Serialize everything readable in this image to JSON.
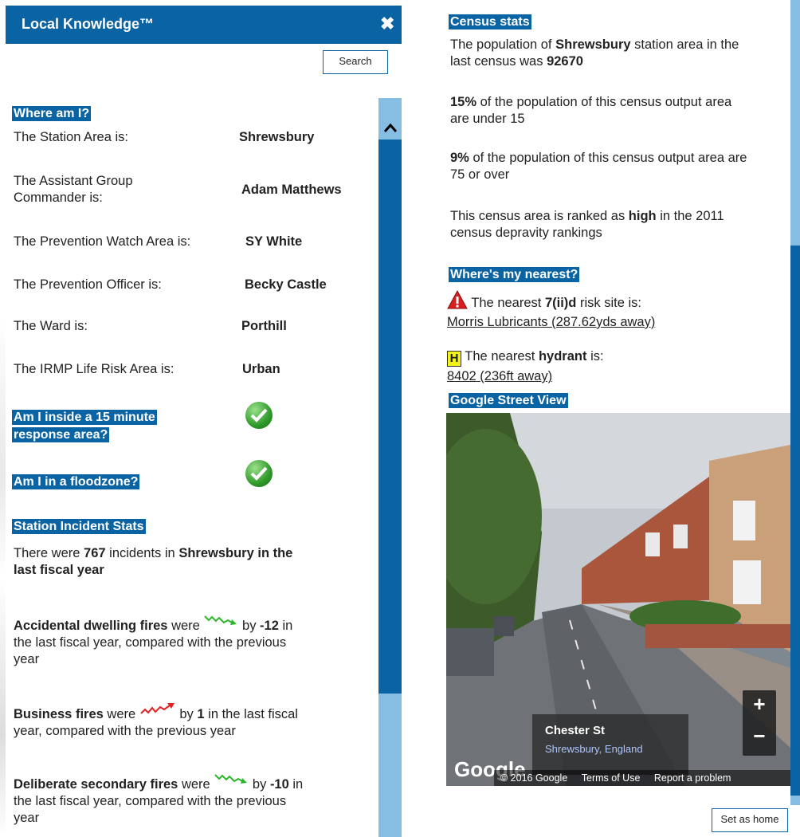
{
  "header": {
    "title": "Local Knowledge™",
    "close": "✖",
    "search_label": "Search"
  },
  "where": {
    "heading": "Where am I?",
    "rows": [
      {
        "label": "The Station Area is:",
        "value": "Shrewsbury"
      },
      {
        "label": "The Assistant Group",
        "label2": "Commander is:",
        "value": "Adam Matthews"
      },
      {
        "label": "The Prevention Watch Area is:",
        "value": "SY White"
      },
      {
        "label": "The Prevention Officer is:",
        "value": "Becky Castle"
      },
      {
        "label": "The Ward is:",
        "value": "Porthill"
      },
      {
        "label": "The IRMP Life Risk Area is:",
        "value": "Urban"
      }
    ],
    "response_q1": "Am I inside a 15 minute",
    "response_q2": "response area?",
    "flood_q": "Am I in a floodzone?"
  },
  "incidents": {
    "heading": "Station Incident Stats",
    "intro_pre": "There were",
    "count": "767",
    "intro_mid": "incidents in",
    "station": "Shrewsbury in the",
    "intro_end": "last fiscal year",
    "stats": [
      {
        "name": "Accidental dwelling fires",
        "verb": "were",
        "by": "by",
        "change": "-12",
        "line1_tail": "in",
        "line2": "the last fiscal year, compared with the previous",
        "line3": "year",
        "trend": "down"
      },
      {
        "name": "Business fires",
        "verb": "were",
        "by": "by",
        "change": "1",
        "line1_tail": "in the last fiscal",
        "line2": "year, compared with the previous year",
        "trend": "up"
      },
      {
        "name": "Deliberate secondary fires",
        "verb": "were",
        "by": "by",
        "change": "-10",
        "line1_tail": "in",
        "line2": "the last fiscal year, compared with the previous",
        "line3": "year",
        "trend": "down"
      }
    ]
  },
  "census": {
    "heading": "Census stats",
    "p1_a": "The population of",
    "p1_b": "Shrewsbury",
    "p1_c": "station area in the",
    "p1_d": "last census was",
    "p1_e": "92670",
    "p2_a": "15%",
    "p2_b": "of the population of this census output area",
    "p2_c": "are under 15",
    "p3_a": "9%",
    "p3_b": "of the population of this census output area are",
    "p3_c": "75 or over",
    "p4_a": "This census area is ranked as",
    "p4_b": "high",
    "p4_c": "in the 2011",
    "p4_d": "census depravity rankings"
  },
  "nearest": {
    "heading": "Where's my nearest?",
    "risk_pre": "The nearest",
    "risk_b": "7(ii)d",
    "risk_post": "risk site is:",
    "risk_link": "Morris Lubricants (287.62yds away)",
    "hydrant_icon": "H",
    "hyd_pre": "The nearest",
    "hyd_b": "hydrant",
    "hyd_post": "is:",
    "hyd_link": "8402 (236ft away)"
  },
  "streetview": {
    "heading": "Google Street View",
    "street": "Chester St",
    "town": "Shrewsbury, England",
    "logo": "Google",
    "copyright": "© 2016 Google",
    "terms": "Terms of Use",
    "report": "Report a problem",
    "zoom_in": "+",
    "zoom_out": "−"
  },
  "footer": {
    "set_home": "Set as home"
  },
  "colors": {
    "brand": "#0a64a4",
    "scroll_light": "#85bde3",
    "trend_down": "#2bb52b",
    "trend_up": "#e52222"
  }
}
